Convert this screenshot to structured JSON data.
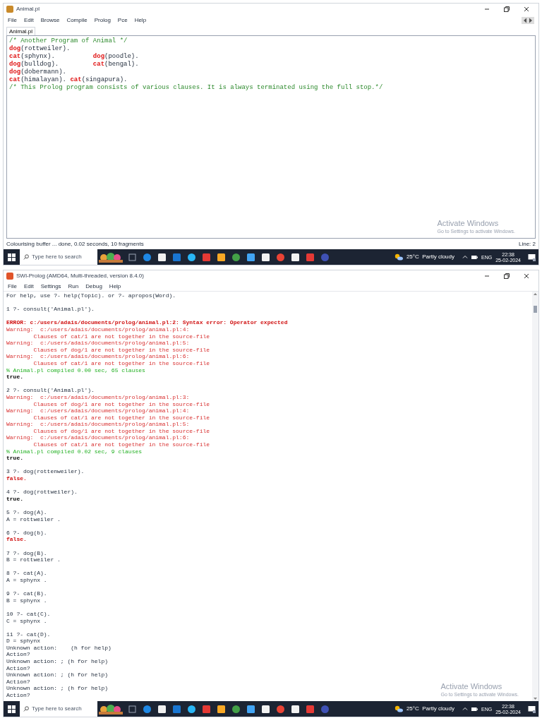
{
  "editor_window": {
    "title": "Animal.pl",
    "menu": [
      "File",
      "Edit",
      "Browse",
      "Compile",
      "Prolog",
      "Pce",
      "Help"
    ],
    "tabs": [
      {
        "label": "Animal.pl",
        "selected": true
      }
    ],
    "lines": [
      [
        {
          "kind": "comment",
          "text": "/* Another Program of Animal */"
        }
      ],
      [
        {
          "kind": "head",
          "text": "dog"
        },
        {
          "kind": "args",
          "text": "(rottweiler)."
        }
      ],
      [
        {
          "kind": "head",
          "text": "cat"
        },
        {
          "kind": "args",
          "text": "(sphynx).          "
        },
        {
          "kind": "head",
          "text": "dog"
        },
        {
          "kind": "args",
          "text": "(poodle)."
        }
      ],
      [
        {
          "kind": "head",
          "text": "dog"
        },
        {
          "kind": "args",
          "text": "(bulldog).         "
        },
        {
          "kind": "head",
          "text": "cat"
        },
        {
          "kind": "args",
          "text": "(bengal)."
        }
      ],
      [
        {
          "kind": "head",
          "text": "dog"
        },
        {
          "kind": "args",
          "text": "(dobermann)."
        }
      ],
      [
        {
          "kind": "head",
          "text": "cat"
        },
        {
          "kind": "args",
          "text": "(himalayan). "
        },
        {
          "kind": "head",
          "text": "cat"
        },
        {
          "kind": "args",
          "text": "(singapura)."
        }
      ],
      [
        {
          "kind": "comment",
          "text": "/* This Prolog program consists of various clauses. It is always terminated using the full stop.*/"
        }
      ]
    ],
    "activation": {
      "title": "Activate Windows",
      "subtitle": "Go to Settings to activate Windows."
    },
    "status_bar": {
      "message": "Colourising buffer ... done, 0.02 seconds, 10 fragments",
      "line": "Line: 2"
    },
    "taskbar": {
      "search": "Type here to search",
      "weather": "25°C  Partly cloudy",
      "language": "ENG",
      "time": "22:38",
      "date": "25-02-2024"
    }
  },
  "console_window": {
    "title": "SWI-Prolog (AMD64, Multi-threaded, version 8.4.0)",
    "menu": [
      "File",
      "Edit",
      "Settings",
      "Run",
      "Debug",
      "Help"
    ],
    "blocks": [
      [
        {
          "kind": "plain",
          "text": "For help, use ?- help(Topic). or ?- apropos(Word)."
        }
      ],
      [
        {
          "kind": "plain",
          "text": "1 ?- consult('Animal.pl')."
        }
      ],
      [
        {
          "kind": "error",
          "text": "ERROR: c:/users/adais/documents/prolog/animal.pl:2: Syntax error: Operator expected"
        },
        {
          "kind": "warning",
          "text": "Warning:  c:/users/adais/documents/prolog/animal.pl:4:"
        },
        {
          "kind": "warning",
          "text": "        Clauses of cat/1 are not together in the source-file"
        },
        {
          "kind": "warning",
          "text": "Warning:  c:/users/adais/documents/prolog/animal.pl:5:"
        },
        {
          "kind": "warning",
          "text": "        Clauses of dog/1 are not together in the source-file"
        },
        {
          "kind": "warning",
          "text": "Warning:  c:/users/adais/documents/prolog/animal.pl:6:"
        },
        {
          "kind": "warning",
          "text": "        Clauses of cat/1 are not together in the source-file"
        },
        {
          "kind": "success",
          "text": "% Animal.pl compiled 0.00 sec, 65 clauses"
        },
        {
          "kind": "true",
          "text": "true."
        }
      ],
      [
        {
          "kind": "plain",
          "text": "2 ?- consult('Animal.pl')."
        },
        {
          "kind": "warning",
          "text": "Warning:  c:/users/adais/documents/prolog/animal.pl:3:"
        },
        {
          "kind": "warning",
          "text": "        Clauses of dog/1 are not together in the source-file"
        },
        {
          "kind": "warning",
          "text": "Warning:  c:/users/adais/documents/prolog/animal.pl:4:"
        },
        {
          "kind": "warning",
          "text": "        Clauses of cat/1 are not together in the source-file"
        },
        {
          "kind": "warning",
          "text": "Warning:  c:/users/adais/documents/prolog/animal.pl:5:"
        },
        {
          "kind": "warning",
          "text": "        Clauses of dog/1 are not together in the source-file"
        },
        {
          "kind": "warning",
          "text": "Warning:  c:/users/adais/documents/prolog/animal.pl:6:"
        },
        {
          "kind": "warning",
          "text": "        Clauses of cat/1 are not together in the source-file"
        },
        {
          "kind": "success",
          "text": "% Animal.pl compiled 0.02 sec, 9 clauses"
        },
        {
          "kind": "true",
          "text": "true."
        }
      ],
      [
        {
          "kind": "plain",
          "text": "3 ?- dog(rottenweiler)."
        },
        {
          "kind": "false",
          "text": "false."
        }
      ],
      [
        {
          "kind": "plain",
          "text": "4 ?- dog(rottweiler)."
        },
        {
          "kind": "true",
          "text": "true."
        }
      ],
      [
        {
          "kind": "plain",
          "text": "5 ?- dog(A)."
        },
        {
          "kind": "plain",
          "text": "A = rottweiler ."
        }
      ],
      [
        {
          "kind": "plain",
          "text": "6 ?- dog(b)."
        },
        {
          "kind": "false",
          "text": "false."
        }
      ],
      [
        {
          "kind": "plain",
          "text": "7 ?- dog(B)."
        },
        {
          "kind": "plain",
          "text": "B = rottweiler ."
        }
      ],
      [
        {
          "kind": "plain",
          "text": "8 ?- cat(A)."
        },
        {
          "kind": "plain",
          "text": "A = sphynx ."
        }
      ],
      [
        {
          "kind": "plain",
          "text": "9 ?- cat(B)."
        },
        {
          "kind": "plain",
          "text": "B = sphynx ."
        }
      ],
      [
        {
          "kind": "plain",
          "text": "10 ?- cat(C)."
        },
        {
          "kind": "plain",
          "text": "C = sphynx ."
        }
      ],
      [
        {
          "kind": "plain",
          "text": "11 ?- cat(D)."
        },
        {
          "kind": "plain",
          "text": "D = sphynx"
        },
        {
          "kind": "plain",
          "text": "Unknown action:    (h for help)"
        },
        {
          "kind": "plain",
          "text": "Action?"
        },
        {
          "kind": "plain",
          "text": "Unknown action: ; (h for help)"
        },
        {
          "kind": "plain",
          "text": "Action?"
        },
        {
          "kind": "plain",
          "text": "Unknown action: ; (h for help)"
        },
        {
          "kind": "plain",
          "text": "Action?"
        },
        {
          "kind": "plain",
          "text": "Unknown action: ; (h for help)"
        },
        {
          "kind": "plain",
          "text": "Action?"
        }
      ]
    ],
    "activation": {
      "title": "Activate Windows",
      "subtitle": "Go to Settings to activate Windows."
    },
    "taskbar": {
      "search": "Type here to search",
      "weather": "25°C  Partly cloudy",
      "language": "ENG",
      "time": "22:38",
      "date": "25-02-2024"
    }
  }
}
